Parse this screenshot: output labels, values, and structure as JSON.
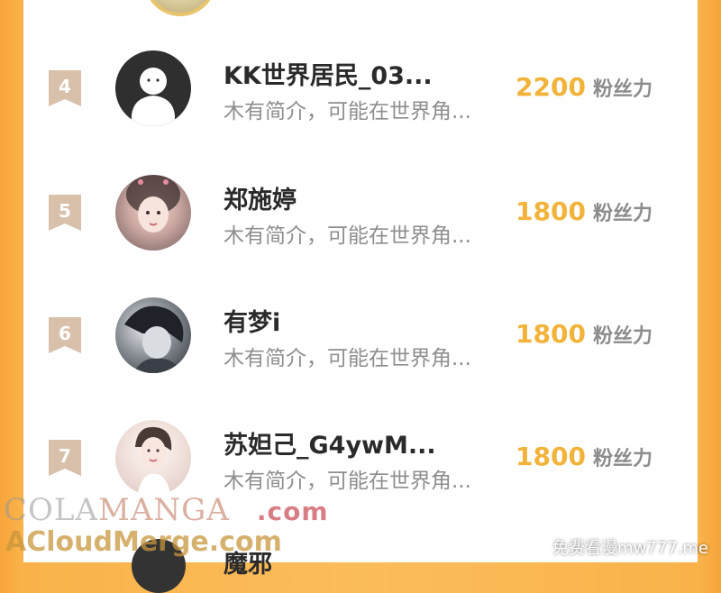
{
  "rows": [
    {
      "rank": "4",
      "name": "KK世界居民_03...",
      "bio": "木有简介，可能在世界角...",
      "fans": "2200",
      "fans_label": "粉丝力",
      "avatar": "default-avatar-icon"
    },
    {
      "rank": "5",
      "name": "郑施婷",
      "bio": "木有简介，可能在世界角...",
      "fans": "1800",
      "fans_label": "粉丝力",
      "avatar": "user-photo"
    },
    {
      "rank": "6",
      "name": "有梦i",
      "bio": "木有简介，可能在世界角...",
      "fans": "1800",
      "fans_label": "粉丝力",
      "avatar": "user-photo"
    },
    {
      "rank": "7",
      "name": "苏妲己_G4ywM...",
      "bio": "木有简介，可能在世界角...",
      "fans": "1800",
      "fans_label": "粉丝力",
      "avatar": "user-photo"
    }
  ],
  "partial_row": {
    "name": "魔邪"
  },
  "watermarks": {
    "cola": "COLA",
    "manga": "MANGA",
    "dotcom": ".com",
    "acloud": "ACloudMerge.com",
    "mw": "免费看漫mw777.me"
  },
  "colors": {
    "accent": "#f2b33a",
    "badge": "#d8c0ab",
    "background": "#fbbd5a"
  }
}
